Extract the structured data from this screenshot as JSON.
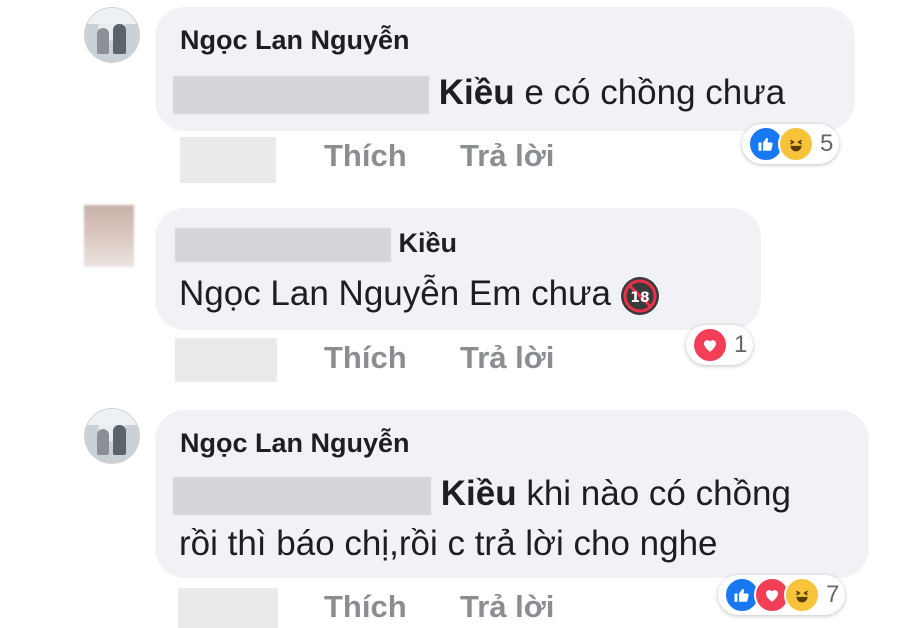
{
  "comments": [
    {
      "author": "Ngọc Lan Nguyễn",
      "mention": "Kiều",
      "text": "e có chồng chưa",
      "like_label": "Thích",
      "reply_label": "Trả lời",
      "reaction_icons": [
        "like-icon",
        "haha-icon"
      ],
      "reaction_count": "5"
    },
    {
      "author": "Kiều",
      "text": "Ngọc Lan Nguyễn Em chưa",
      "badge_icon": "no-under-18-icon",
      "like_label": "Thích",
      "reply_label": "Trả lời",
      "reaction_icons": [
        "love-icon"
      ],
      "reaction_count": "1"
    },
    {
      "author": "Ngọc Lan Nguyễn",
      "mention": "Kiều",
      "text_line1": "khi nào có chồng",
      "text_line2": "rồi thì báo chị,rồi c trả lời cho nghe",
      "like_label": "Thích",
      "reply_label": "Trả lời",
      "reaction_icons": [
        "like-icon",
        "love-icon",
        "haha-icon"
      ],
      "reaction_count": "7"
    }
  ],
  "colors": {
    "bubble": "#f0f2f5",
    "text": "#1c1e21",
    "action": "#8a8d91",
    "like": "#1877f2",
    "love": "#f33e58",
    "haha": "#f7c33a"
  }
}
